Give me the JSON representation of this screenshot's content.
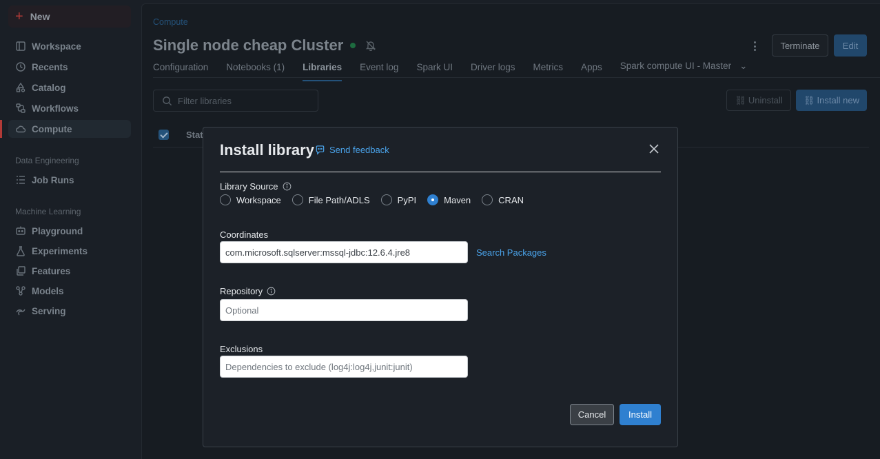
{
  "sidebar": {
    "new_label": "New",
    "items": [
      {
        "label": "Workspace"
      },
      {
        "label": "Recents"
      },
      {
        "label": "Catalog"
      },
      {
        "label": "Workflows"
      },
      {
        "label": "Compute"
      }
    ],
    "sections": [
      {
        "title": "Data Engineering",
        "items": [
          {
            "label": "Job Runs"
          }
        ]
      },
      {
        "title": "Machine Learning",
        "items": [
          {
            "label": "Playground"
          },
          {
            "label": "Experiments"
          },
          {
            "label": "Features"
          },
          {
            "label": "Models"
          },
          {
            "label": "Serving"
          }
        ]
      }
    ],
    "active_item": "Compute"
  },
  "header": {
    "breadcrumb": "Compute",
    "title": "Single node cheap Cluster",
    "status_color": "#1d6b3f",
    "terminate_label": "Terminate",
    "edit_label": "Edit"
  },
  "tabs": [
    {
      "label": "Configuration"
    },
    {
      "label": "Notebooks (1)"
    },
    {
      "label": "Libraries",
      "active": true
    },
    {
      "label": "Event log"
    },
    {
      "label": "Spark UI"
    },
    {
      "label": "Driver logs"
    },
    {
      "label": "Metrics"
    },
    {
      "label": "Apps"
    },
    {
      "label": "Spark compute UI - Master"
    }
  ],
  "libraries": {
    "filter_placeholder": "Filter libraries",
    "uninstall_label": "Uninstall",
    "install_new_label": "Install new",
    "column_header": "Stat"
  },
  "modal": {
    "title": "Install library",
    "feedback_label": "Send feedback",
    "library_source_label": "Library Source",
    "sources": [
      {
        "label": "Workspace",
        "checked": false
      },
      {
        "label": "File Path/ADLS",
        "checked": false
      },
      {
        "label": "PyPI",
        "checked": false
      },
      {
        "label": "Maven",
        "checked": true
      },
      {
        "label": "CRAN",
        "checked": false
      }
    ],
    "coordinates_label": "Coordinates",
    "coordinates_value": "com.microsoft.sqlserver:mssql-jdbc:12.6.4.jre8",
    "search_packages_label": "Search Packages",
    "repository_label": "Repository",
    "repository_placeholder": "Optional",
    "exclusions_label": "Exclusions",
    "exclusions_placeholder": "Dependencies to exclude (log4j:log4j,junit:junit)",
    "cancel_label": "Cancel",
    "install_label": "Install",
    "accent_color": "#2f80d0"
  }
}
